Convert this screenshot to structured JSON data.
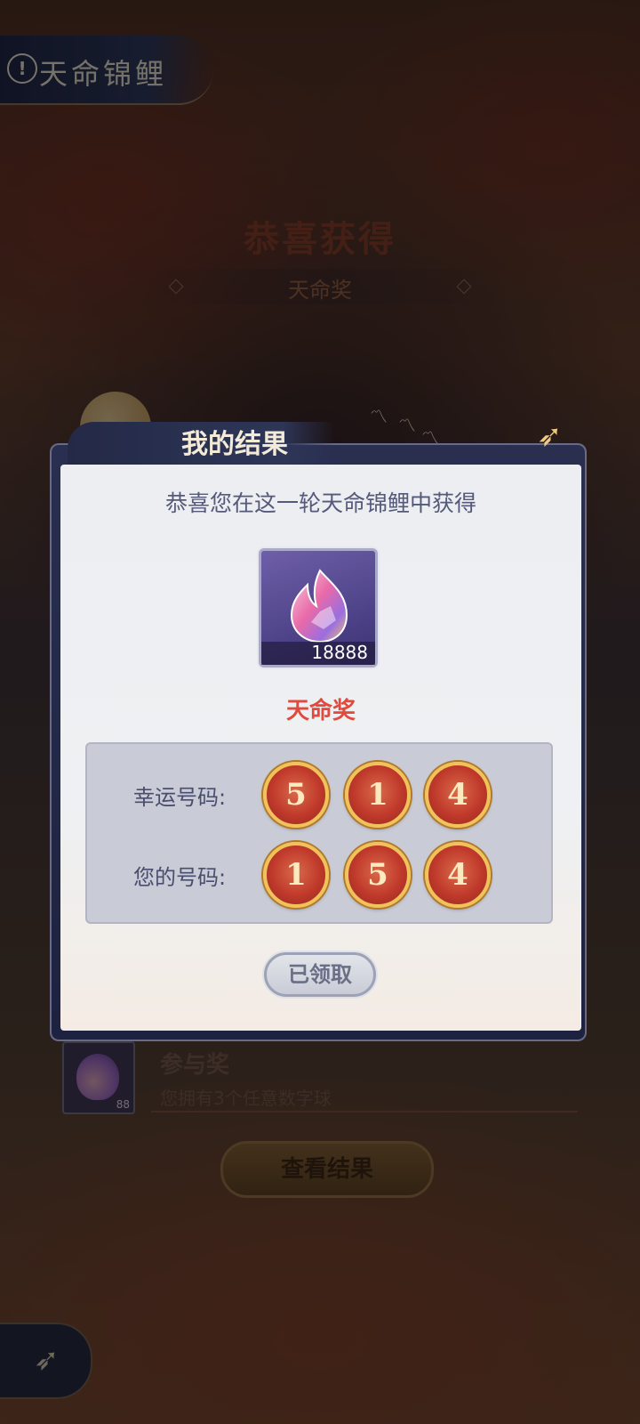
{
  "top_banner": {
    "icon": "alert-icon",
    "title": "天命锦鲤"
  },
  "background_card": {
    "title": "恭喜获得",
    "subtitle": "天命奖",
    "participation_prize": {
      "title": "参与奖",
      "description": "您拥有3个任意数字球",
      "item_count": "88"
    },
    "view_result_label": "查看结果"
  },
  "dialog": {
    "title": "我的结果",
    "message": "恭喜您在这一轮天命锦鲤中获得",
    "reward_item": {
      "icon": "crystal-gem-icon",
      "count": "18888"
    },
    "prize_name": "天命奖",
    "lucky_numbers_label": "幸运号码:",
    "lucky_numbers": [
      "5",
      "1",
      "4"
    ],
    "your_numbers_label": "您的号码:",
    "your_numbers": [
      "1",
      "5",
      "4"
    ],
    "claimed_label": "已领取"
  },
  "colors": {
    "prize_red": "#e14a3c",
    "ball_red": "#c0392b",
    "ball_rim": "#f1c25a",
    "dialog_navy": "#2a2f50"
  }
}
